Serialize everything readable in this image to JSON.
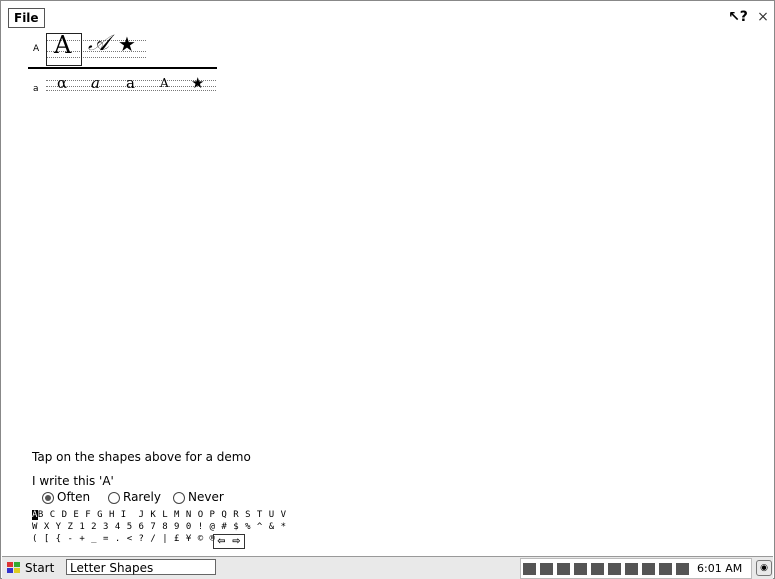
{
  "menu": {
    "file_label": "File"
  },
  "titlebar": {
    "help_label": "?",
    "close_label": "×"
  },
  "rows": {
    "upper": {
      "label": "A",
      "shapes": [
        "A",
        "𝒜",
        "★"
      ]
    },
    "lower": {
      "label": "a",
      "shapes": [
        "α",
        "a",
        "a",
        "A",
        "★"
      ]
    }
  },
  "hint": "Tap on the shapes above for a demo",
  "frequency": {
    "question": "I write this 'A'",
    "options": [
      "Often",
      "Rarely",
      "Never"
    ],
    "selected": "Often"
  },
  "charmap": {
    "line1_selected": "A",
    "line1_rest": "B C D E F G H I  J K L M N O P Q R S T U V",
    "line2": "W X Y Z 1 2 3 4 5 6 7 8 9 0 ! @ # $ % ^ & *",
    "line3": "( [ { - + _ = . < ? / | £ ¥ © ®"
  },
  "arrows": {
    "left": "⇦",
    "right": "⇨"
  },
  "taskbar": {
    "start_label": "Start",
    "task_label": "Letter Shapes",
    "clock": "6:01 AM"
  }
}
